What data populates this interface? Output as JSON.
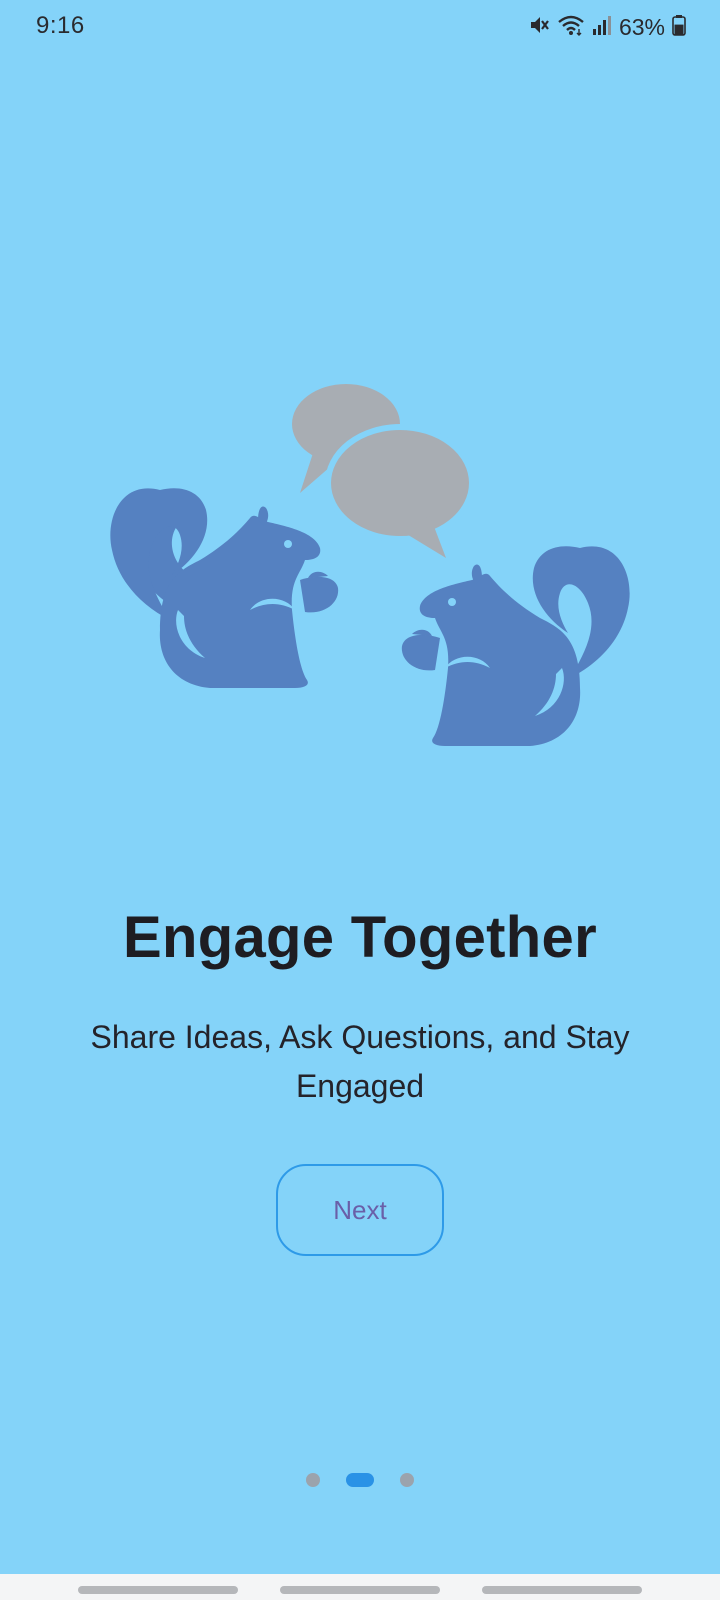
{
  "status_bar": {
    "time": "9:16",
    "battery_percent": "63%",
    "icons": [
      "mute-icon",
      "wifi-icon",
      "signal-icon",
      "battery-icon"
    ],
    "battery_level": 0.63
  },
  "illustration": {
    "icon": "squirrels-chatting-illustration",
    "colors": {
      "squirrel": "#5581c1",
      "speech_bubble": "#a8adb3"
    }
  },
  "onboarding": {
    "title": "Engage Together",
    "subtitle": "Share Ideas, Ask Questions, and Stay Engaged",
    "next_label": "Next"
  },
  "pager": {
    "page_count": 3,
    "current_page": 2
  },
  "colors": {
    "background": "#84d3f9",
    "accent": "#2a92e6",
    "button_text": "#6a5fa8",
    "inactive_dot": "#9ba3ad"
  }
}
